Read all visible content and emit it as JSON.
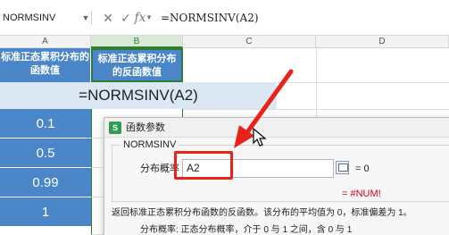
{
  "formula_bar": {
    "name_box": "NORMSINV",
    "cancel_icon": "✕",
    "confirm_icon": "✓",
    "fx_label": "fx",
    "formula": "=NORMSINV(A2)"
  },
  "columns": [
    "A",
    "B",
    "C",
    "D"
  ],
  "headers": {
    "a_line1": "标准正态累积分布的",
    "a_line2": "函数值",
    "b_line1": "标准正态累积分布",
    "b_line2": "的反函数值"
  },
  "merged_cell_text": "=NORMSINV(A2)",
  "values": [
    "0.1",
    "0.5",
    "0.99",
    "1"
  ],
  "dialog": {
    "title": "函数参数",
    "function_name": "NORMSINV",
    "arg_label": "分布概率",
    "arg_value": "A2",
    "arg_result": "= 0",
    "result": "= #NUM!",
    "description": "返回标准正态累积分布函数的反函数。该分布的平均值为 0，标准偏差为 1。",
    "param_description": "分布概率:  正态分布概率，介于 0 与 1 之间，含 0 与 1"
  },
  "colors": {
    "header_blue": "#4a86c8",
    "merged_fill": "#dbe8f4",
    "highlight_red": "#e8231a",
    "error_red": "#d0021b",
    "excel_green": "#2f7d32"
  }
}
